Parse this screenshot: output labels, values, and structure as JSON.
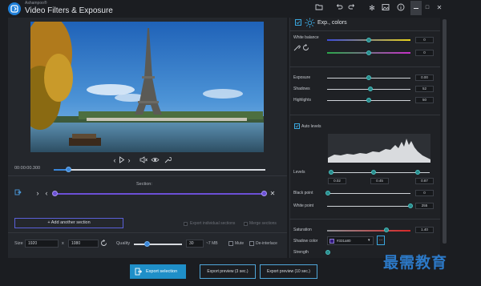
{
  "app": {
    "brand": "Ashampoo®",
    "title": "Video Filters & Exposure"
  },
  "player": {
    "timecode": "00:00:00.300",
    "progress": 0.05
  },
  "section": {
    "label": "Section:",
    "add_label": "+ Add another section",
    "export_individual": "Export individual sections",
    "merge_sections": "Merge sections"
  },
  "output": {
    "size_label": "Size",
    "width": "1920",
    "x_label": "x",
    "height": "1080",
    "quality_label": "Quality",
    "quality_value": "30",
    "est_size": "~7 MB",
    "mute_label": "Mute",
    "deinterlace_label": "De-interlace"
  },
  "buttons": {
    "export_selection": "Export selection",
    "export_preview_3": "Export preview (3 sec.)",
    "export_preview_10": "Export preview (10 sec.)"
  },
  "panel": {
    "title": "Exp., colors",
    "white_balance_label": "White balance",
    "white_balance_values": [
      "0",
      "0"
    ],
    "exposure_label": "Exposure",
    "exposure_value": "0.00",
    "shadows_label": "Shadows",
    "shadows_value": "52",
    "highlights_label": "Highlights",
    "highlights_value": "50",
    "auto_levels_label": "Auto levels",
    "levels_label": "Levels",
    "levels_values": [
      "0.02",
      "0.45",
      "0.87"
    ],
    "black_point_label": "Black point",
    "black_point_value": "0",
    "white_point_label": "White point",
    "white_point_value": "255",
    "saturation_label": "Saturation",
    "saturation_value": "1.40",
    "shadow_color_label": "Shadow color",
    "shadow_color_value": "#331a80",
    "strength_label": "Strength"
  },
  "colors": {
    "accent_blue": "#1f8fc8",
    "knob_teal": "#2a8c8c",
    "section_purple": "#6b4fd6",
    "shadow_swatch": "#331a80"
  },
  "watermark": "最需教育"
}
